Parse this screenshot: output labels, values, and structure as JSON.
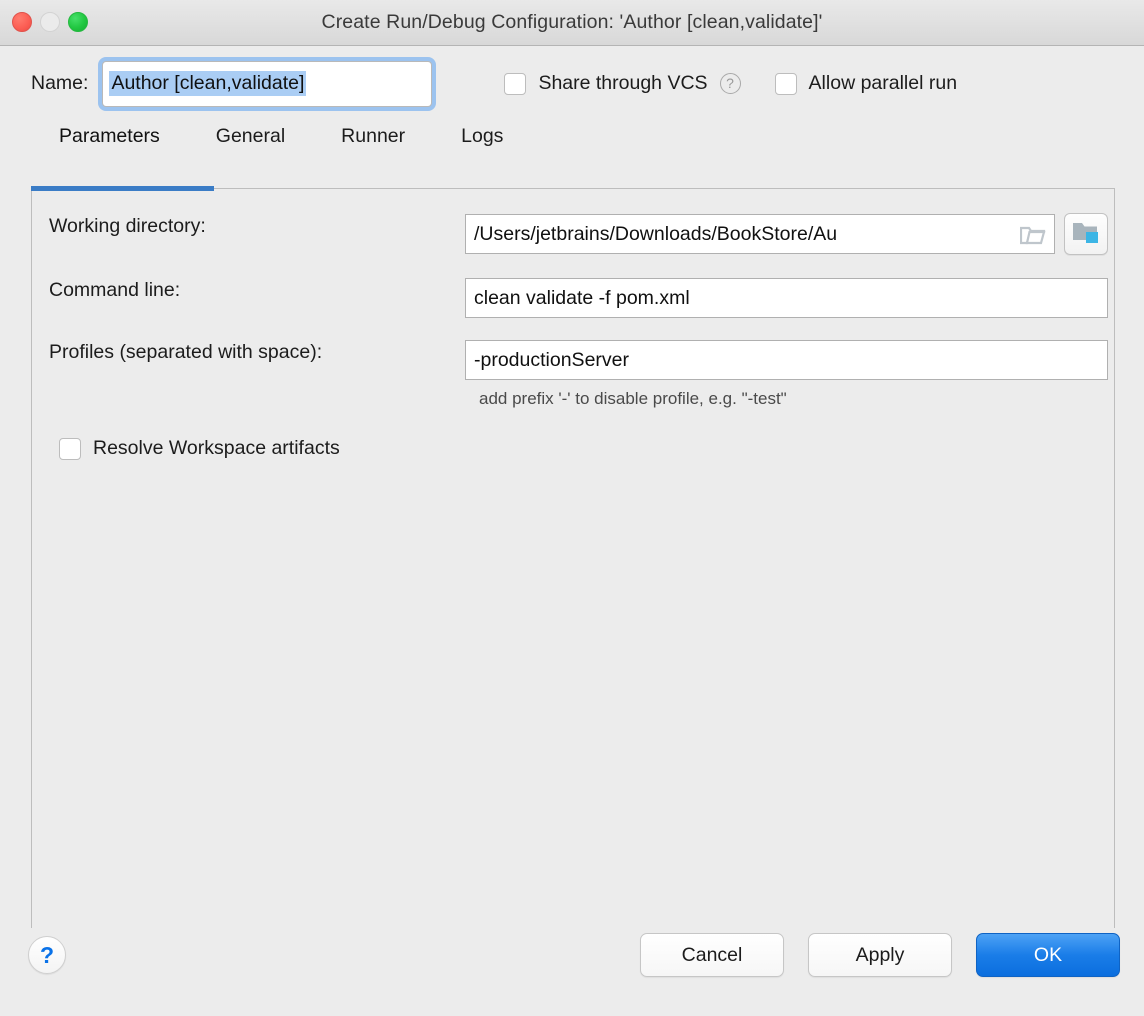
{
  "window": {
    "title": "Create Run/Debug Configuration: 'Author [clean,validate]'",
    "traffic_lights": {
      "close": "close-window-button",
      "minimize": "minimize-window-button",
      "maximize": "maximize-window-button"
    }
  },
  "name_row": {
    "label": "Name:",
    "value": "Author [clean,validate]",
    "placeholder": "Name",
    "share_vcs": {
      "label": "Share through VCS",
      "checked": false,
      "help_glyph": "?"
    },
    "allow_parallel": {
      "label": "Allow parallel run",
      "checked": false
    }
  },
  "tabs": [
    {
      "label": "Parameters",
      "active": true
    },
    {
      "label": "General",
      "active": false
    },
    {
      "label": "Runner",
      "active": false
    },
    {
      "label": "Logs",
      "active": false
    }
  ],
  "form": {
    "working_directory": {
      "label": "Working directory:",
      "value": "/Users/jetbrains/Downloads/BookStore/Au",
      "placeholder": "Working directory",
      "inline_icon": "open-folder-icon",
      "browse_button_icon": "module-folder-icon"
    },
    "command_line": {
      "label": "Command line:",
      "value": "clean validate -f pom.xml",
      "placeholder": "Command line"
    },
    "profiles": {
      "label": "Profiles (separated with space):",
      "value": "-productionServer",
      "placeholder": "Profiles",
      "hint": "add prefix '-' to disable profile, e.g. \"-test\""
    },
    "resolve_workspace_artifacts": {
      "label": "Resolve Workspace artifacts",
      "checked": false
    }
  },
  "footer": {
    "help_glyph": "?",
    "cancel_label": "Cancel",
    "apply_label": "Apply",
    "ok_label": "OK"
  },
  "colors": {
    "accent_blue": "#3a7cc6",
    "primary_button": "#1a7de8",
    "selection_blue": "#aacdf4",
    "focus_ring": "#9cc3ef",
    "window_bg": "#ececec",
    "badge_cyan": "#3cb5e5"
  }
}
